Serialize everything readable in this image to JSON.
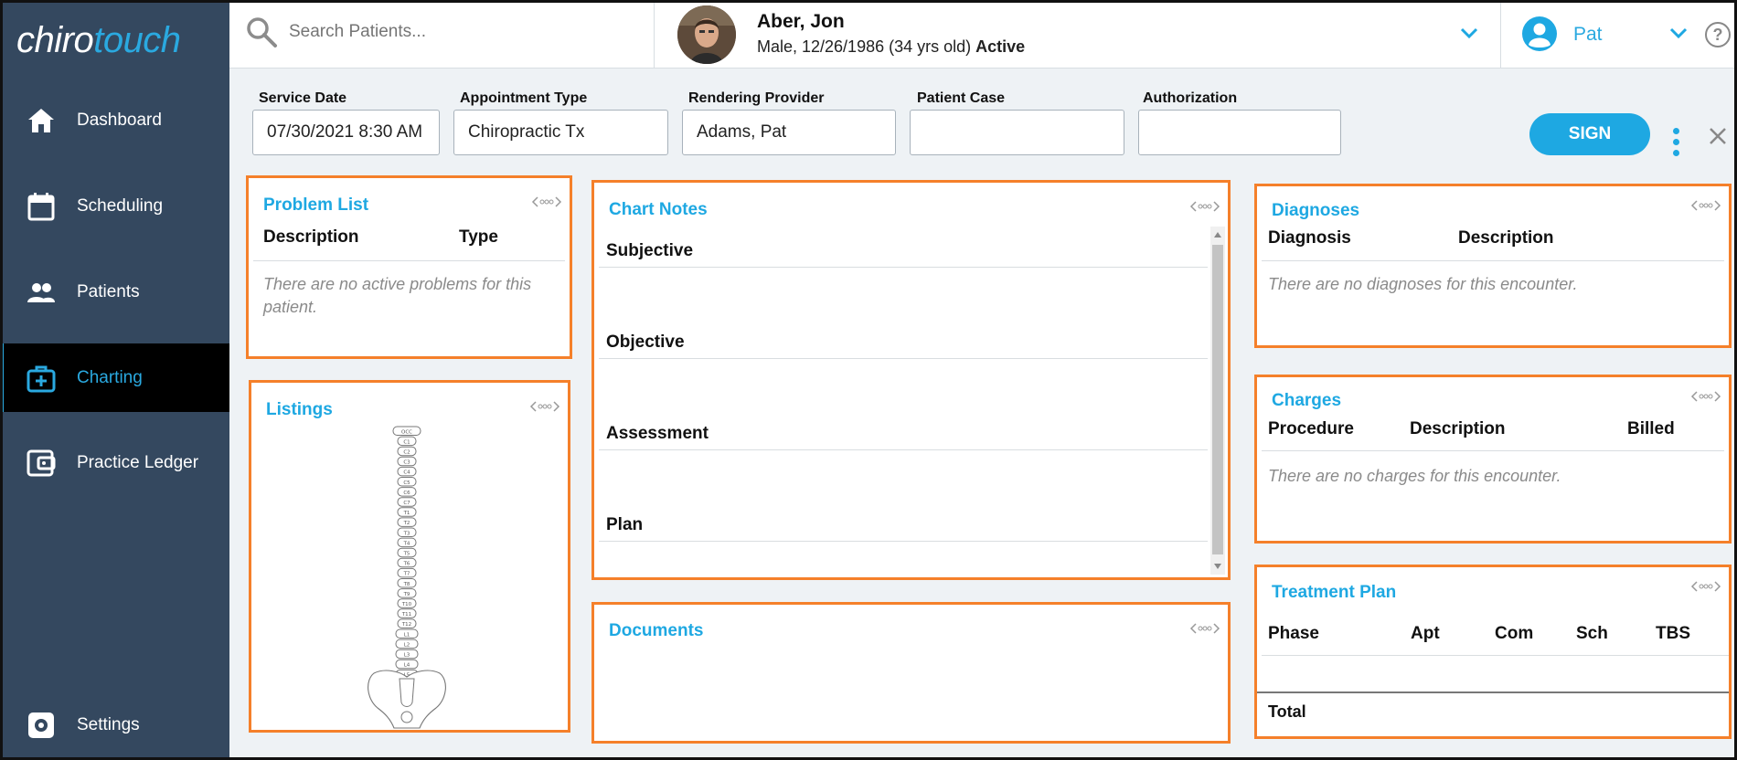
{
  "app": {
    "logo_part1": "chiro",
    "logo_part2": "touch"
  },
  "sidebar": {
    "items": [
      {
        "label": "Dashboard",
        "icon": "home-icon"
      },
      {
        "label": "Scheduling",
        "icon": "calendar-icon"
      },
      {
        "label": "Patients",
        "icon": "people-icon"
      },
      {
        "label": "Charting",
        "icon": "medical-kit-icon",
        "active": true
      },
      {
        "label": "Practice Ledger",
        "icon": "wallet-icon"
      }
    ],
    "settings_label": "Settings"
  },
  "topbar": {
    "search_placeholder": "Search Patients...",
    "patient_name": "Aber, Jon",
    "patient_info": "Male, 12/26/1986 (34 yrs old)",
    "patient_status": "Active",
    "user_name": "Pat",
    "help_glyph": "?"
  },
  "encounter": {
    "service_date_label": "Service Date",
    "service_date_value": "07/30/2021 8:30 AM",
    "appointment_type_label": "Appointment Type",
    "appointment_type_value": "Chiropractic Tx",
    "rendering_provider_label": "Rendering Provider",
    "rendering_provider_value": "Adams, Pat",
    "patient_case_label": "Patient Case",
    "patient_case_value": "",
    "authorization_label": "Authorization",
    "authorization_value": "",
    "sign_label": "SIGN"
  },
  "problem_list": {
    "title": "Problem List",
    "col_description": "Description",
    "col_type": "Type",
    "empty": "There are no active problems for this patient."
  },
  "listings": {
    "title": "Listings",
    "vertebrae": [
      "OCC",
      "C1",
      "C2",
      "C3",
      "C4",
      "C5",
      "C6",
      "C7",
      "T1",
      "T2",
      "T3",
      "T4",
      "T5",
      "T6",
      "T7",
      "T8",
      "T9",
      "T10",
      "T11",
      "T12",
      "L1",
      "L2",
      "L3",
      "L4",
      "L5"
    ]
  },
  "chart_notes": {
    "title": "Chart Notes",
    "sections": [
      "Subjective",
      "Objective",
      "Assessment",
      "Plan"
    ]
  },
  "documents": {
    "title": "Documents"
  },
  "diagnoses": {
    "title": "Diagnoses",
    "col_diagnosis": "Diagnosis",
    "col_description": "Description",
    "empty": "There are no diagnoses for this encounter."
  },
  "charges": {
    "title": "Charges",
    "col_procedure": "Procedure",
    "col_description": "Description",
    "col_billed": "Billed",
    "empty": "There are no charges for this encounter."
  },
  "treatment_plan": {
    "title": "Treatment Plan",
    "col_phase": "Phase",
    "col_apt": "Apt",
    "col_com": "Com",
    "col_sch": "Sch",
    "col_tbs": "TBS",
    "total_label": "Total"
  },
  "colors": {
    "accent": "#1ea8e2",
    "highlight": "#f5802a",
    "sidebar": "#34485f"
  }
}
